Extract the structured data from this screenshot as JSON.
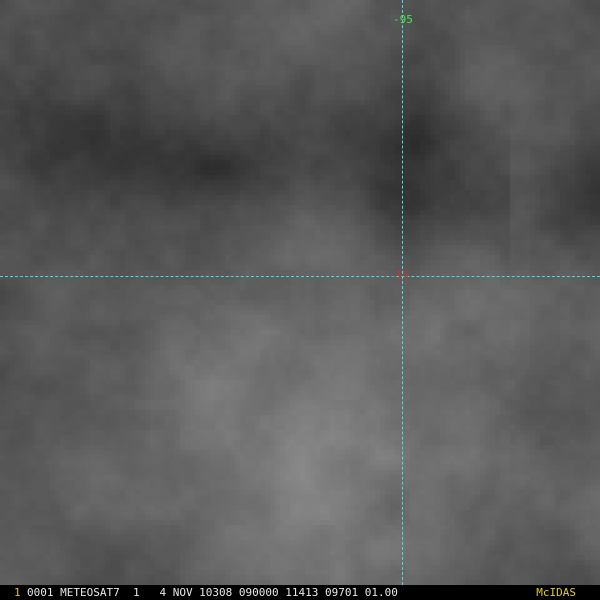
{
  "image": {
    "satellite": "METEOSAT7",
    "description_colors": {
      "crosshair": "#3fe0e0",
      "lon_label": "#50e050",
      "lat_label": "#d03030",
      "frame_index": "#e0c020",
      "logo": "#e0d020",
      "status_text": "#e8e8e8"
    }
  },
  "overlay": {
    "lon_label": "-95",
    "lat_label": "-15"
  },
  "status_bar": {
    "frame_index": "1",
    "header": "0001 METEOSAT7  1   4 NOV 10308 090000 11413 09701 01.00",
    "logo": "McIDAS"
  }
}
